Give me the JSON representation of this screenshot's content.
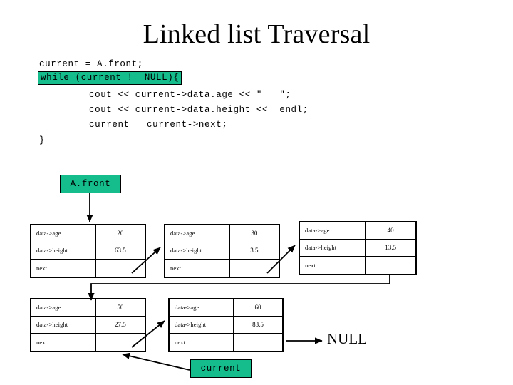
{
  "slide": {
    "title": "Linked list Traversal",
    "background_color": "#ffffff",
    "accent_color": "#15BD8D",
    "line_color": "#000000"
  },
  "code": {
    "lines": [
      {
        "text": "current = A.front;",
        "highlighted": false
      },
      {
        "text": "while (current != NULL){",
        "highlighted": true
      },
      {
        "text": "cout << current->data.age << \"   \";",
        "highlighted": false
      },
      {
        "text": "cout << current->data.height <<  endl;",
        "highlighted": false
      },
      {
        "text": "current = current->next;",
        "highlighted": false
      },
      {
        "text": "}",
        "highlighted": false
      }
    ]
  },
  "pointers": {
    "head_label": "A.front",
    "current_label": "current",
    "terminator_label": "NULL"
  },
  "diagram": {
    "row_labels": [
      "data->age",
      "data->height",
      "next"
    ],
    "nodes": [
      {
        "age": "20",
        "height": "63.5",
        "next": ""
      },
      {
        "age": "30",
        "height": "3.5",
        "next": ""
      },
      {
        "age": "40",
        "height": "13.5",
        "next": ""
      },
      {
        "age": "50",
        "height": "27.5",
        "next": ""
      },
      {
        "age": "60",
        "height": "83.5",
        "next": ""
      }
    ]
  }
}
